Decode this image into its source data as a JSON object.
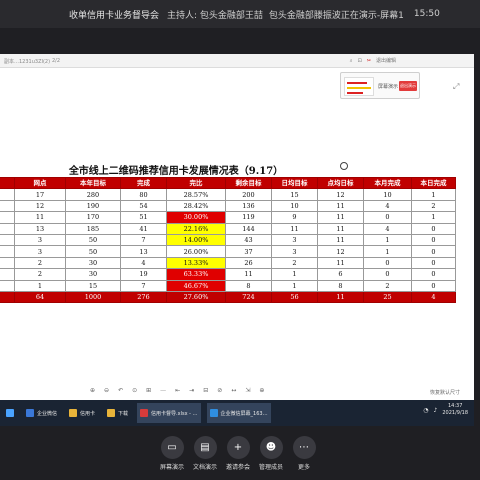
{
  "meeting": {
    "title": "收单信用卡业务督导会",
    "host": "主持人: 包头金融部王喆",
    "presenting": "包头金融部滕振波正在演示-屏幕1",
    "clock": "15:50"
  },
  "viewer": {
    "file_name": "副本…1231u3ZI(2)",
    "page_indicator": "2/2",
    "tools_right": [
      "⌕",
      "⊡",
      "✂",
      "退出编辑"
    ],
    "thumb_label": "屏幕演示",
    "thumb_button": "退出演示",
    "bottom_tools": [
      "⊕",
      "⊖",
      "↶",
      "⊙",
      "⊞",
      "⇤",
      "⇥",
      "⊟",
      "⊘",
      "↔",
      "⇲",
      "⊕"
    ],
    "zoom_label": "—",
    "bottom_right": "恢复默认尺寸",
    "expand_icon": "expand-icon"
  },
  "sheet": {
    "title": "全市线上二维码推荐信用卡发展情况表（9.17）",
    "headers": [
      "",
      "网点",
      "本年目标",
      "完成",
      "完比",
      "剩余目标",
      "日均目标",
      "点均日标",
      "本月完成",
      "本日完成"
    ],
    "rows": [
      {
        "cells": [
          "",
          "17",
          "280",
          "80",
          "28.57%",
          "200",
          "15",
          "12",
          "10",
          "1"
        ],
        "status": "none"
      },
      {
        "cells": [
          "",
          "12",
          "190",
          "54",
          "28.42%",
          "136",
          "10",
          "11",
          "4",
          "2"
        ],
        "status": "none"
      },
      {
        "cells": [
          "",
          "11",
          "170",
          "51",
          "30.00%",
          "119",
          "9",
          "11",
          "0",
          "1"
        ],
        "status": "red"
      },
      {
        "cells": [
          "",
          "13",
          "185",
          "41",
          "22.16%",
          "144",
          "11",
          "11",
          "4",
          "0"
        ],
        "status": "yellow"
      },
      {
        "cells": [
          "",
          "3",
          "50",
          "7",
          "14.00%",
          "43",
          "3",
          "11",
          "1",
          "0"
        ],
        "status": "yellow"
      },
      {
        "cells": [
          "",
          "3",
          "50",
          "13",
          "26.00%",
          "37",
          "3",
          "12",
          "1",
          "0"
        ],
        "status": "none"
      },
      {
        "cells": [
          "",
          "2",
          "30",
          "4",
          "13.33%",
          "26",
          "2",
          "11",
          "0",
          "0"
        ],
        "status": "yellow"
      },
      {
        "cells": [
          "",
          "2",
          "30",
          "19",
          "63.33%",
          "11",
          "1",
          "6",
          "0",
          "0"
        ],
        "status": "red"
      },
      {
        "cells": [
          "",
          "1",
          "15",
          "7",
          "46.67%",
          "8",
          "1",
          "8",
          "2",
          "0"
        ],
        "status": "red"
      }
    ],
    "total": [
      "",
      "64",
      "1000",
      "276",
      "27.60%",
      "724",
      "56",
      "11",
      "25",
      "4"
    ]
  },
  "taskbar": {
    "items": [
      {
        "label": "企业微信",
        "icon": "search-icon",
        "color": "#3a78d8"
      },
      {
        "label": "信用卡",
        "icon": "folder-icon",
        "color": "#e8b43a"
      },
      {
        "label": "下载",
        "icon": "folder-icon",
        "color": "#e8b43a"
      },
      {
        "label": "信用卡督导.xlsx - …",
        "icon": "wps-icon",
        "color": "#d63b3b"
      },
      {
        "label": "企业微信屏幕_163…",
        "icon": "chat-icon",
        "color": "#2f8ee0"
      }
    ],
    "time": "14:37",
    "date": "2021/9/18"
  },
  "footer": {
    "buttons": [
      {
        "label": "屏幕演示",
        "glyph": "▭"
      },
      {
        "label": "文档演示",
        "glyph": "▤"
      },
      {
        "label": "邀请参会",
        "glyph": "+"
      },
      {
        "label": "管理成员",
        "glyph": "☻"
      },
      {
        "label": "更多",
        "glyph": "⋯"
      }
    ]
  }
}
